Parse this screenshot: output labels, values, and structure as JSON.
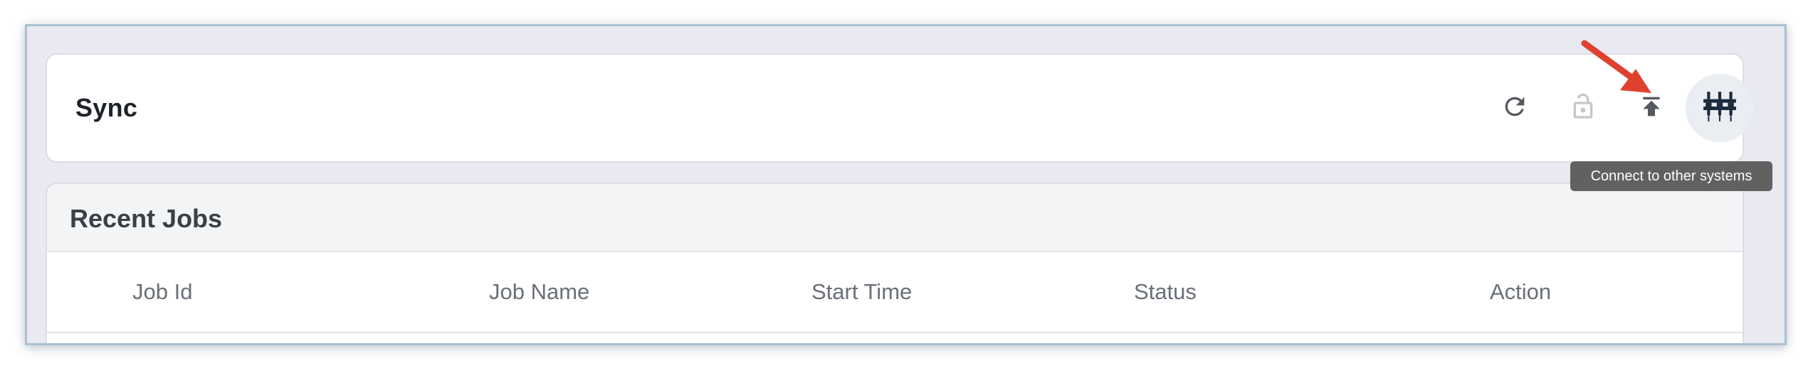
{
  "page": {
    "title": "Sync"
  },
  "toolbar": {
    "buttons": [
      {
        "id": "refresh",
        "icon": "refresh-icon",
        "disabled": false
      },
      {
        "id": "unlock",
        "icon": "unlock-icon",
        "disabled": true
      },
      {
        "id": "upload",
        "icon": "upload-to-top-icon",
        "disabled": false
      },
      {
        "id": "connect",
        "icon": "connectors-icon",
        "disabled": false,
        "highlighted": true
      }
    ],
    "tooltip": "Connect to other systems"
  },
  "jobs": {
    "title": "Recent Jobs",
    "columns": [
      "Job Id",
      "Job Name",
      "Start Time",
      "Status",
      "Action"
    ],
    "rows": []
  },
  "annotation": {
    "arrow_color": "#e0412f"
  },
  "colors": {
    "icon": "#55595f",
    "icon_disabled": "#c4c7cc",
    "icon_active": "#1c2a3d"
  }
}
